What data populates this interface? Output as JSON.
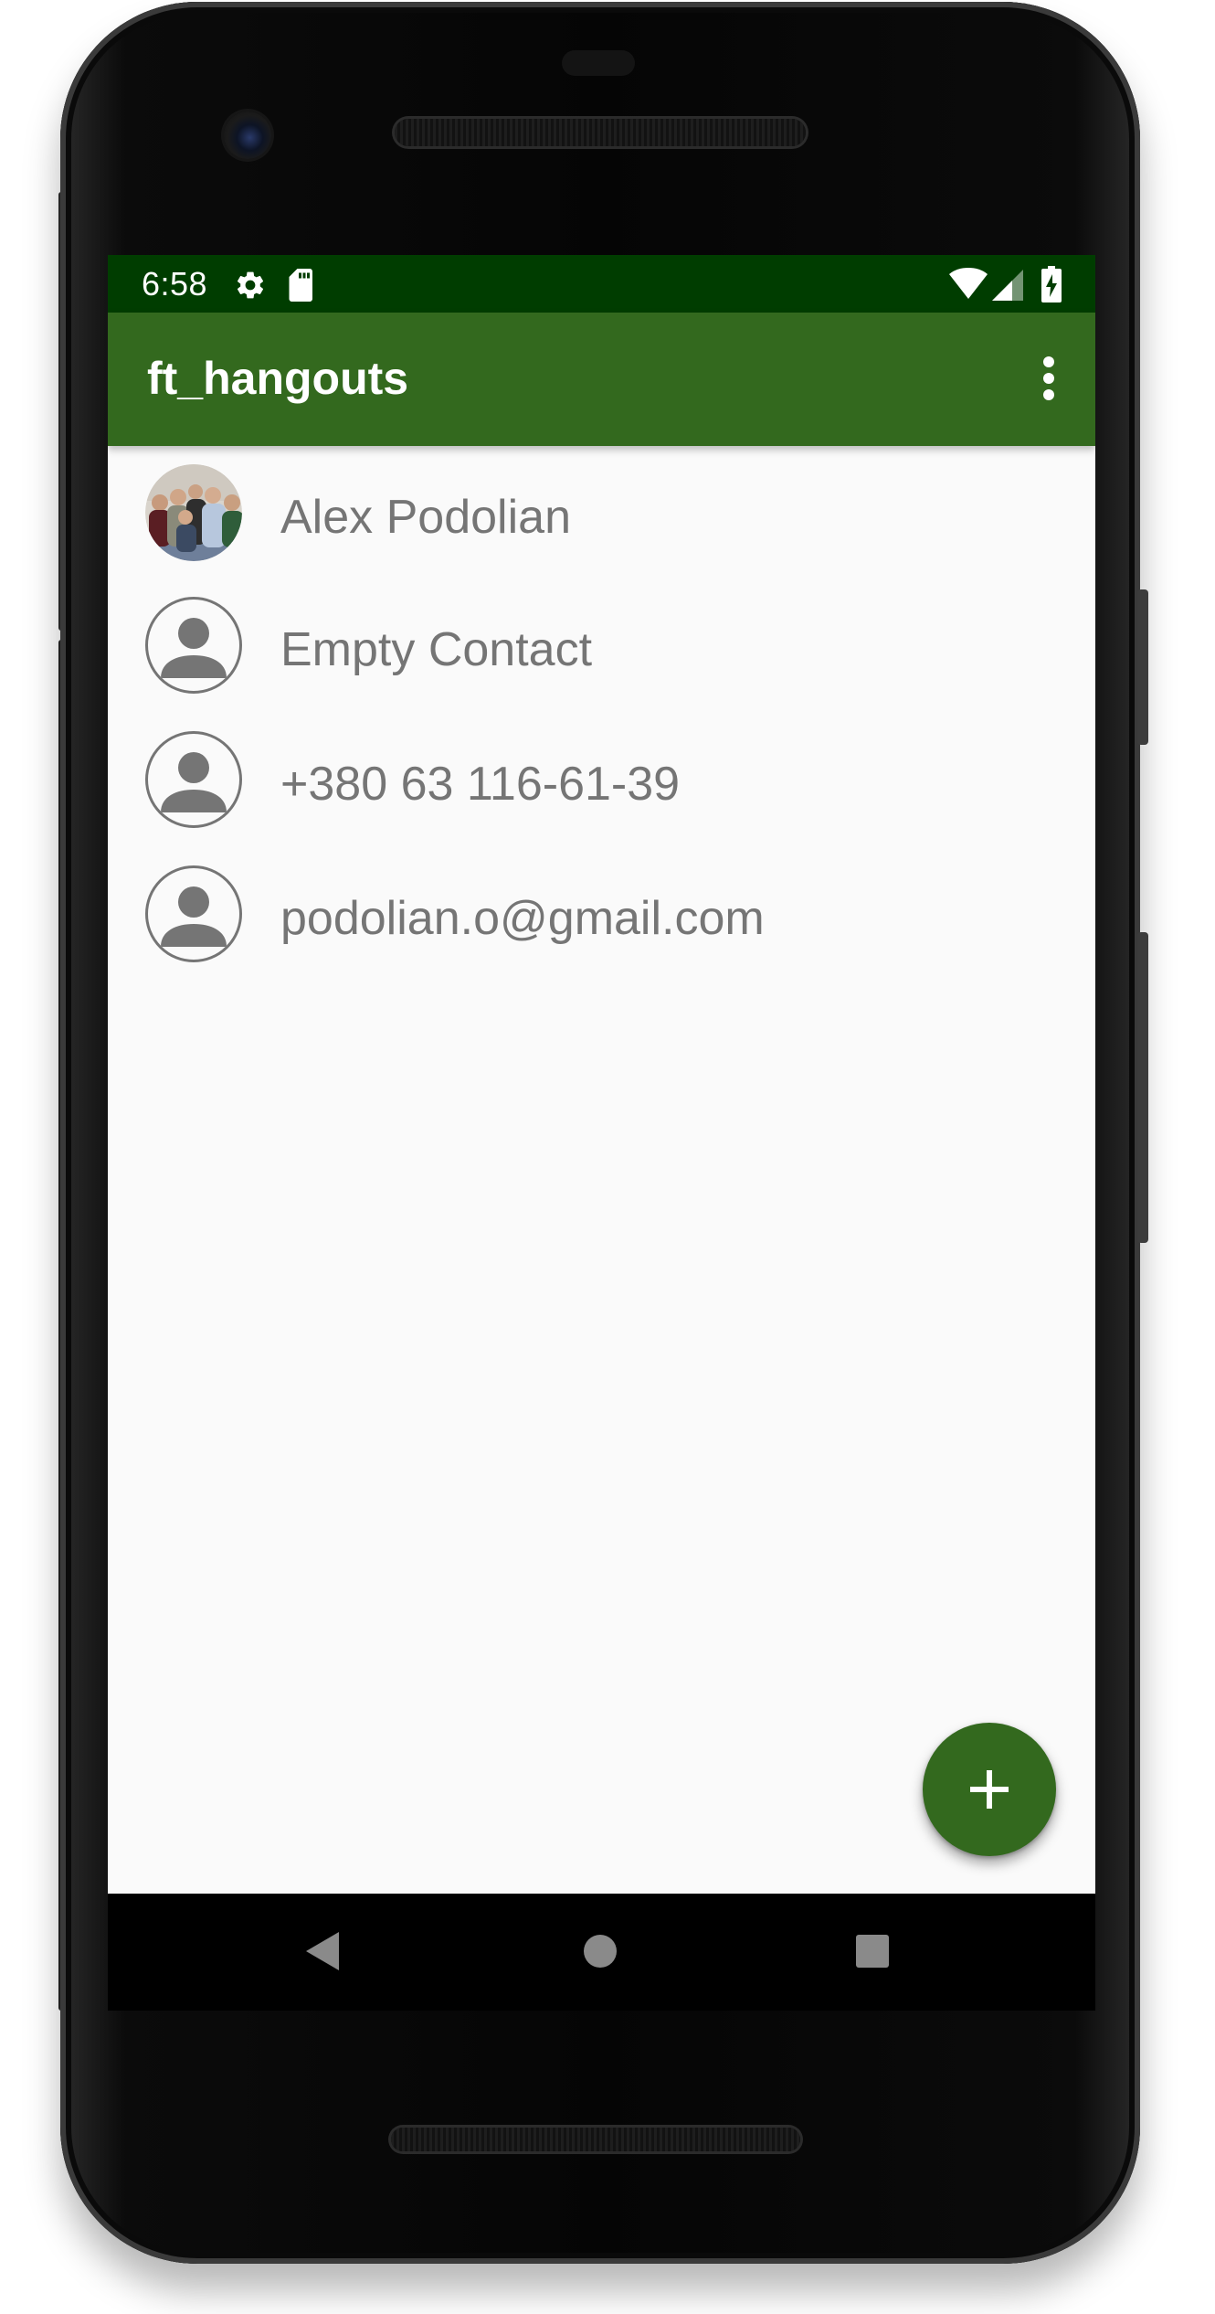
{
  "status_bar": {
    "time": "6:58",
    "icons": [
      "gear-icon",
      "sd-card-icon",
      "wifi-icon",
      "cell-signal-icon",
      "battery-charging-icon"
    ]
  },
  "app_bar": {
    "title": "ft_hangouts",
    "menu_icon": "more-vert-icon"
  },
  "contacts": [
    {
      "name": "Alex Podolian",
      "avatar": "photo"
    },
    {
      "name": "Empty Contact",
      "avatar": "person-placeholder-icon"
    },
    {
      "name": "+380 63 116-61-39",
      "avatar": "person-placeholder-icon"
    },
    {
      "name": "podolian.o@gmail.com",
      "avatar": "person-placeholder-icon"
    }
  ],
  "fab": {
    "icon": "plus-icon"
  },
  "nav_bar": {
    "buttons": [
      "back-icon",
      "home-icon",
      "recents-icon"
    ]
  },
  "colors": {
    "status_bar": "#003d00",
    "app_bar": "#33691e",
    "fab": "#33691e",
    "background": "#fafafa",
    "contact_text": "#757575"
  }
}
